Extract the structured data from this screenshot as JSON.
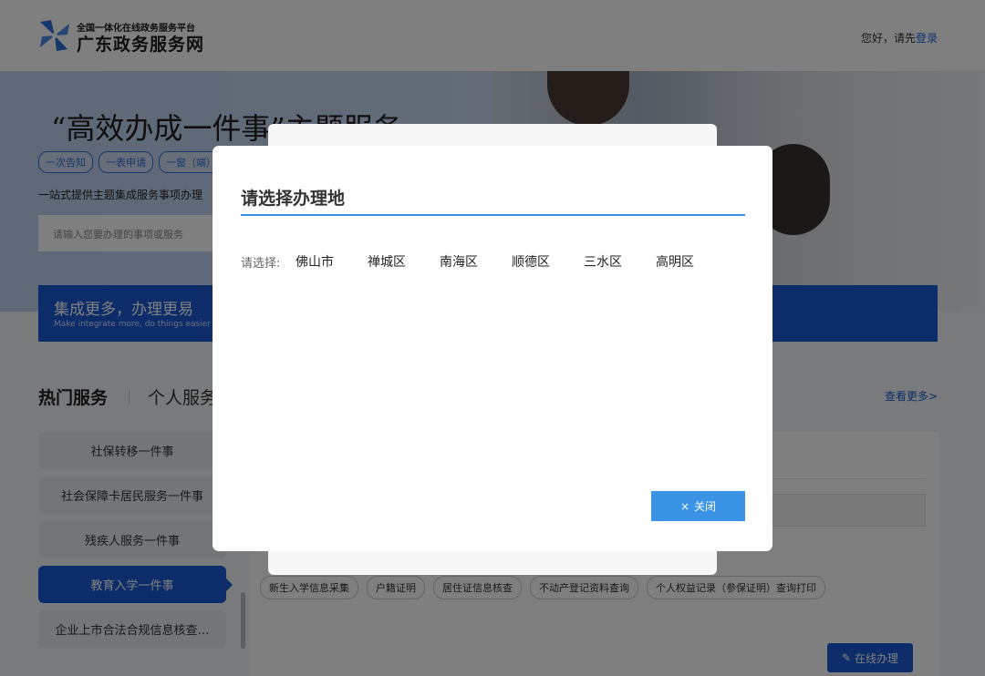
{
  "header": {
    "platform_subtitle": "全国一体化在线政务服务平台",
    "site_name": "广东政务服务网",
    "greeting": "您好，请先",
    "login": "登录"
  },
  "banner": {
    "title": "“高效办成一件事”主题服务",
    "tags": [
      "一次告知",
      "一表申请",
      "一窗（端）"
    ],
    "desc": "一站式提供主题集成服务事项办理",
    "search_placeholder": "请输入您要办理的事项或服务"
  },
  "blue_bar": {
    "title": "集成更多，办理更易",
    "subtitle": "Make integrate more, do things easier"
  },
  "services": {
    "tab_hot": "热门服务",
    "tab_personal": "个人服务",
    "more": "查看更多>",
    "side_items": [
      "社保转移一件事",
      "社会保障卡居民服务一件事",
      "残疾人服务一件事",
      "教育入学一件事",
      "企业上市合法合规信息核查…"
    ],
    "chips": [
      "新生入学信息采集",
      "户籍证明",
      "居住证信息核查",
      "不动产登记资料查询",
      "个人权益记录（参保证明）查询打印"
    ],
    "online_button": "在线办理"
  },
  "modal": {
    "title": "请选择办理地",
    "label": "请选择:",
    "options": [
      "佛山市",
      "禅城区",
      "南海区",
      "顺德区",
      "三水区",
      "高明区"
    ],
    "close": "关闭"
  },
  "colors": {
    "primary": "#1a5bd4",
    "modal_accent": "#3b93e6"
  }
}
